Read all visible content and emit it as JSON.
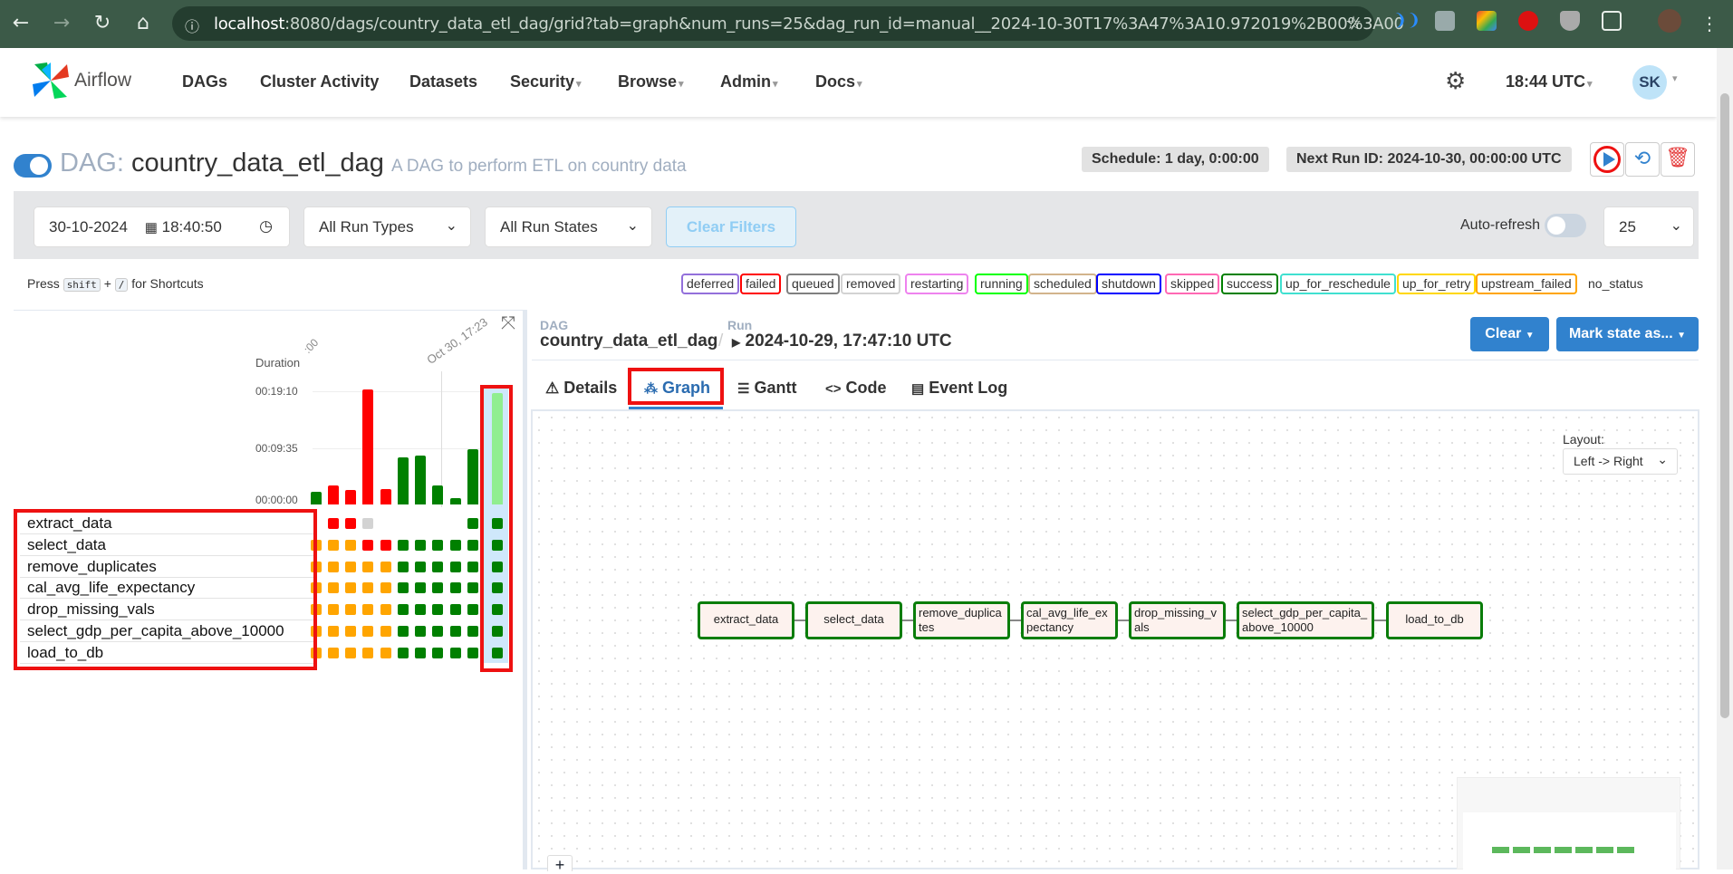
{
  "browser": {
    "url_host": "localhost",
    "url_rest": ":8080/dags/country_data_etl_dag/grid?tab=graph&num_runs=25&dag_run_id=manual__2024-10-30T17%3A47%3A10.972019%2B00%3A00"
  },
  "nav": {
    "brand": "Airflow",
    "items": [
      "DAGs",
      "Cluster Activity",
      "Datasets",
      "Security",
      "Browse",
      "Admin",
      "Docs"
    ],
    "time": "18:44 UTC",
    "avatar": "SK"
  },
  "header": {
    "dag_prefix": "DAG:",
    "dag_id": "country_data_etl_dag",
    "description": "A DAG to perform ETL on country data",
    "schedule": "Schedule: 1 day, 0:00:00",
    "next_run": "Next Run ID: 2024-10-30, 00:00:00 UTC"
  },
  "filters": {
    "date": "30-10-2024",
    "time": "18:40:50",
    "run_types": "All Run Types",
    "run_states": "All Run States",
    "clear_filters": "Clear Filters",
    "auto_refresh": "Auto-refresh",
    "num_runs": "25"
  },
  "shortcuts": {
    "press": "Press",
    "key1": "shift",
    "plus": "+",
    "key2": "/",
    "suffix": "for Shortcuts"
  },
  "legend": [
    {
      "label": "deferred",
      "color": "#9370db"
    },
    {
      "label": "failed",
      "color": "#ff0000"
    },
    {
      "label": "queued",
      "color": "#808080"
    },
    {
      "label": "removed",
      "color": "#d3d3d3"
    },
    {
      "label": "restarting",
      "color": "#ee82ee"
    },
    {
      "label": "running",
      "color": "#00ff00"
    },
    {
      "label": "scheduled",
      "color": "#d2b48c"
    },
    {
      "label": "shutdown",
      "color": "#0000ff"
    },
    {
      "label": "skipped",
      "color": "#ff69b4"
    },
    {
      "label": "success",
      "color": "#008000"
    },
    {
      "label": "up_for_reschedule",
      "color": "#40e0d0"
    },
    {
      "label": "up_for_retry",
      "color": "#ffd700"
    },
    {
      "label": "upstream_failed",
      "color": "#ffa500"
    },
    {
      "label": "no_status",
      "color": ""
    }
  ],
  "grid": {
    "duration_label": "Duration",
    "date_label_1": ":00",
    "date_label_2": "Oct 30, 17:23",
    "duration_ticks": [
      "00:19:10",
      "00:09:35",
      "00:00:00"
    ],
    "run_durations_sec": [
      130,
      195,
      145,
      1170,
      160,
      480,
      500,
      190,
      60,
      565,
      1130
    ],
    "run_states": [
      "success",
      "failed",
      "failed",
      "failed",
      "failed",
      "success",
      "success",
      "success",
      "success",
      "success",
      "running"
    ],
    "tasks": [
      "extract_data",
      "select_data",
      "remove_duplicates",
      "cal_avg_life_expectancy",
      "drop_missing_vals",
      "select_gdp_per_capita_above_10000",
      "load_to_db"
    ],
    "task_states": [
      [
        "",
        "failed",
        "failed",
        "removed",
        "",
        "",
        "",
        "",
        "",
        "success",
        "success"
      ],
      [
        "upstream_failed",
        "upstream_failed",
        "upstream_failed",
        "failed",
        "failed",
        "success",
        "success",
        "success",
        "success",
        "success",
        "success"
      ],
      [
        "upstream_failed",
        "upstream_failed",
        "upstream_failed",
        "upstream_failed",
        "upstream_failed",
        "success",
        "success",
        "success",
        "success",
        "success",
        "success"
      ],
      [
        "upstream_failed",
        "upstream_failed",
        "upstream_failed",
        "upstream_failed",
        "upstream_failed",
        "success",
        "success",
        "success",
        "success",
        "success",
        "success"
      ],
      [
        "upstream_failed",
        "upstream_failed",
        "upstream_failed",
        "upstream_failed",
        "upstream_failed",
        "success",
        "success",
        "success",
        "success",
        "success",
        "success"
      ],
      [
        "upstream_failed",
        "upstream_failed",
        "upstream_failed",
        "upstream_failed",
        "upstream_failed",
        "success",
        "success",
        "success",
        "success",
        "success",
        "success"
      ],
      [
        "upstream_failed",
        "upstream_failed",
        "upstream_failed",
        "upstream_failed",
        "upstream_failed",
        "success",
        "success",
        "success",
        "success",
        "success",
        "success"
      ]
    ]
  },
  "run_panel": {
    "dag_caption": "DAG",
    "dag_id": "country_data_etl_dag",
    "run_caption": "Run",
    "run_id": "2024-10-29, 17:47:10 UTC",
    "clear": "Clear",
    "mark_state": "Mark state as...",
    "tabs": [
      "Details",
      "Graph",
      "Gantt",
      "Code",
      "Event Log"
    ],
    "layout_label": "Layout:",
    "layout_value": "Left -> Right",
    "zoom_plus": "+"
  },
  "graph_nodes": [
    "extract_data",
    "select_data",
    "remove_duplicates",
    "cal_avg_life_expectancy",
    "drop_missing_vals",
    "select_gdp_per_capita_above_10000",
    "load_to_db"
  ],
  "colors": {
    "success": "#008000",
    "failed": "#ff0000",
    "upstream_failed": "#ffa500",
    "removed": "#d3d3d3",
    "running": "#90ee90",
    "accent": "#017cee",
    "highlight": "#e11111"
  }
}
